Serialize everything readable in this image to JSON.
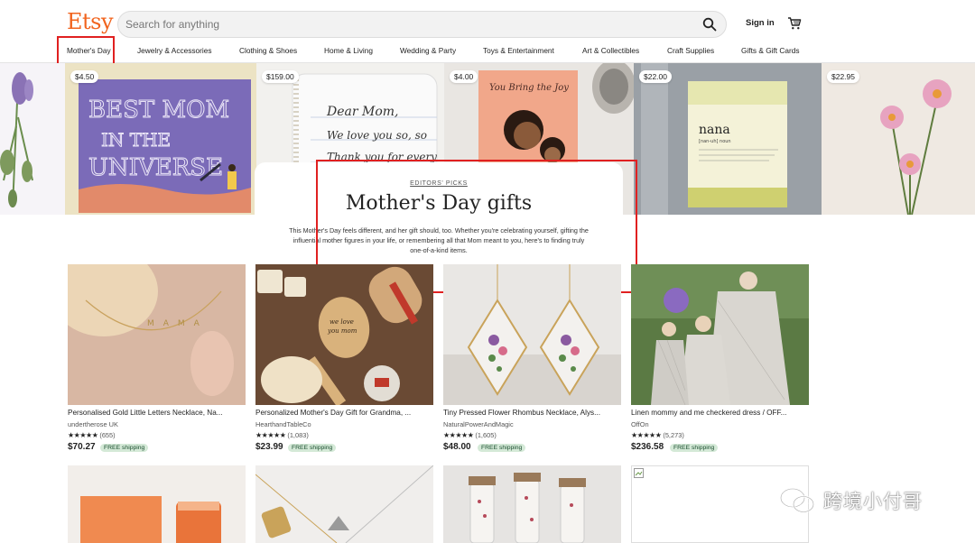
{
  "header": {
    "logo": "Etsy",
    "search_placeholder": "Search for anything",
    "signin_label": "Sign in"
  },
  "nav": [
    "Mother's Day",
    "Jewelry & Accessories",
    "Clothing & Shoes",
    "Home & Living",
    "Wedding & Party",
    "Toys & Entertainment",
    "Art & Collectibles",
    "Craft Supplies",
    "Gifts & Gift Cards"
  ],
  "hero": {
    "prices": [
      "$4.50",
      "$159.00",
      "$4.00",
      "$22.00",
      "$22.95"
    ],
    "card": {
      "eyebrow": "EDITORS' PICKS",
      "title": "Mother's Day gifts",
      "description": "This Mother's Day feels different, and her gift should, too. Whether you're celebrating yourself, gifting the influential mother figures in your life, or remembering all that Mom meant to you, here's to finding truly one-of-a-kind items."
    },
    "art_text": {
      "card1": [
        "BEST MOM",
        "IN THE",
        "UNIVERSE"
      ],
      "card2": [
        "Dear Mom,",
        "We love you so, so",
        "Thank you for every"
      ],
      "card3": "You Bring the Joy",
      "candle_name": "nana",
      "candle_sub": "[nan-uh] noun"
    }
  },
  "products": [
    {
      "title": "Personalised Gold Little Letters Necklace, Na...",
      "shop": "undertherose UK",
      "stars": "★★★★★",
      "reviews": "(655)",
      "price": "$70.27",
      "shipping": "FREE shipping"
    },
    {
      "title": "Personalized Mother's Day Gift for Grandma, ...",
      "shop": "HearthandTableCo",
      "stars": "★★★★★",
      "reviews": "(1,083)",
      "price": "$23.99",
      "shipping": "FREE shipping"
    },
    {
      "title": "Tiny Pressed Flower Rhombus Necklace, Alys...",
      "shop": "NaturalPowerAndMagic",
      "stars": "★★★★★",
      "reviews": "(1,605)",
      "price": "$48.00",
      "shipping": "FREE shipping"
    },
    {
      "title": "Linen mommy and me checkered dress / OFF...",
      "shop": "OffOn",
      "stars": "★★★★★",
      "reviews": "(5,273)",
      "price": "$236.58",
      "shipping": "FREE shipping"
    }
  ],
  "product_art": {
    "necklace_letters": "MAMA",
    "spoon_text": [
      "we love",
      "you mom"
    ]
  },
  "watermark": "跨境小付哥",
  "colors": {
    "brand": "#f1641e",
    "highlight": "#e02020",
    "shipping_badge": "#d4e9d7"
  }
}
